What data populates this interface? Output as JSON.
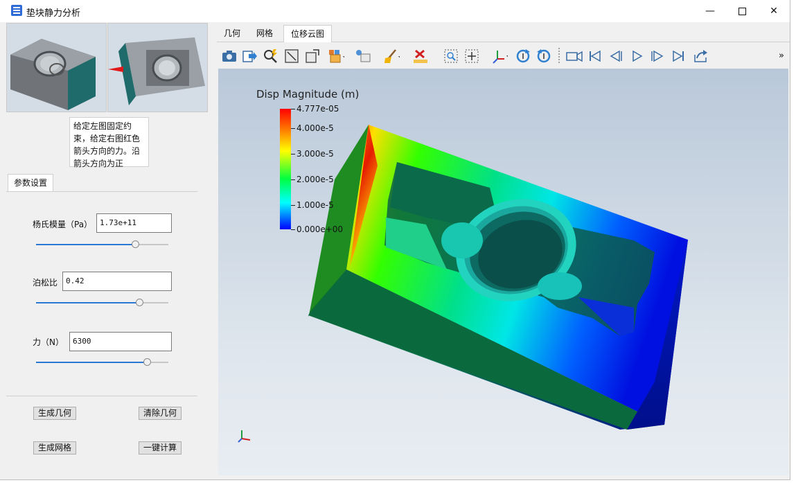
{
  "window": {
    "title": "垫块静力分析",
    "controls": [
      "minimize",
      "maximize",
      "close"
    ]
  },
  "left_panel": {
    "instruction": "给定左图固定约束，给定右图红色箭头方向的力。沿箭头方向为正",
    "tab_label": "参数设置",
    "fields": [
      {
        "label": "杨氏模量（Pa）",
        "value": "1.73e+11",
        "slider_fraction": 0.75
      },
      {
        "label": "泊松比",
        "value": "0.42",
        "slider_fraction": 0.78
      },
      {
        "label": "力（N）",
        "value": "6300",
        "slider_fraction": 0.84
      }
    ],
    "buttons": {
      "generate_geometry": "生成几何",
      "clear_geometry": "清除几何",
      "generate_mesh": "生成网格",
      "one_click_compute": "一键计算"
    }
  },
  "right_panel": {
    "tabs": [
      {
        "label": "几何",
        "active": false
      },
      {
        "label": "网格",
        "active": false
      },
      {
        "label": "位移云图",
        "active": true
      }
    ],
    "toolbar_icons": [
      "camera-icon",
      "export-icon",
      "zoom-search-icon",
      "fit-view-icon",
      "expand-view-icon",
      "box-select-icon",
      "light-icon",
      "clean-icon",
      "delete-icon",
      "zoom-window-icon",
      "pan-icon",
      "axes-icon",
      "rotate-cw-icon",
      "rotate-ccw-icon",
      "video-camera-icon",
      "first-frame-icon",
      "prev-frame-icon",
      "play-icon",
      "next-frame-icon",
      "last-frame-icon",
      "export-animation-icon"
    ],
    "toolbar_more": "»",
    "colorbar": {
      "title": "Disp Magnitude (m)",
      "labels": [
        "4.777e-05",
        "4.000e-5",
        "3.000e-5",
        "2.000e-5",
        "1.000e-5",
        "0.000e+00"
      ],
      "colors": [
        "#ff0000",
        "#ffff00",
        "#00ff40",
        "#00ffff",
        "#0000ff"
      ]
    }
  }
}
